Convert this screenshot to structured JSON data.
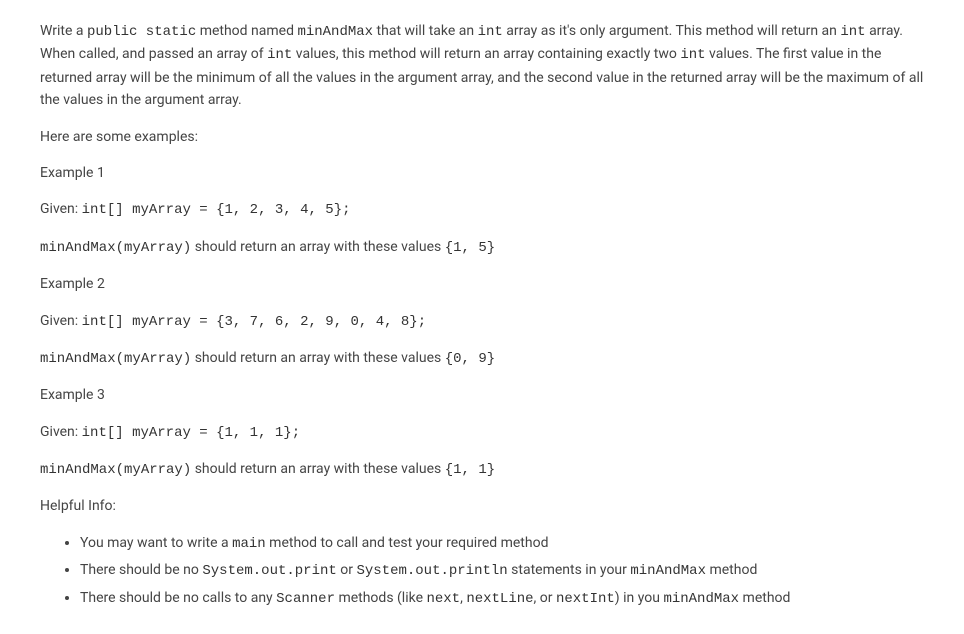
{
  "intro": {
    "part1": "Write a ",
    "code1": "public static",
    "part2": " method named ",
    "code2": "minAndMax",
    "part3": " that will take an ",
    "code3": "int",
    "part4": " array as it's only argument. This method will return an ",
    "code4": "int",
    "part5": " array. When called, and passed an array of ",
    "code5": "int",
    "part6": " values, this method will return an array containing exactly two ",
    "code6": "int",
    "part7": " values. The first value in the returned array will be the minimum of all the values in the argument array, and the second value in the returned array will be the maximum of all the values in the argument array."
  },
  "examples_heading": "Here are some examples:",
  "example1": {
    "title": "Example 1",
    "given_label": "Given: ",
    "given_code": "int[] myArray = {1, 2, 3, 4, 5};",
    "call_code": "minAndMax(myArray)",
    "result_text": " should return an array with these values ",
    "result_code": "{1, 5}"
  },
  "example2": {
    "title": "Example 2",
    "given_label": "Given: ",
    "given_code": "int[] myArray = {3, 7, 6, 2, 9, 0, 4, 8};",
    "call_code": "minAndMax(myArray)",
    "result_text": " should return an array with these values ",
    "result_code": "{0, 9}"
  },
  "example3": {
    "title": "Example 3",
    "given_label": "Given: ",
    "given_code": "int[] myArray = {1, 1, 1};",
    "call_code": "minAndMax(myArray)",
    "result_text": " should return an array with these values ",
    "result_code": "{1, 1}"
  },
  "helpful_info_heading": "Helpful Info:",
  "tips": {
    "tip1": {
      "part1": "You may want to write a ",
      "code1": "main",
      "part2": " method to call and test your required method"
    },
    "tip2": {
      "part1": "There should be no ",
      "code1": "System.out.print",
      "part2": " or ",
      "code2": "System.out.println",
      "part3": " statements in your ",
      "code3": "minAndMax",
      "part4": " method"
    },
    "tip3": {
      "part1": "There should be no calls to any ",
      "code1": "Scanner",
      "part2": " methods (like ",
      "code2": "next",
      "part3": ", ",
      "code3": "nextLine",
      "part4": ", or ",
      "code4": "nextInt",
      "part5": ") in you ",
      "code5": "minAndMax",
      "part6": " method"
    }
  }
}
